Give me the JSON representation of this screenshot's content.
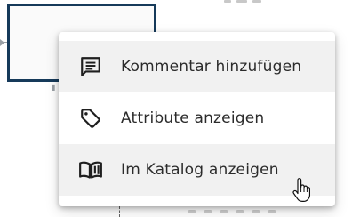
{
  "context_menu": {
    "items": [
      {
        "label": "Kommentar hinzufügen",
        "icon": "comment-icon"
      },
      {
        "label": "Attribute anzeigen",
        "icon": "tag-icon"
      },
      {
        "label": "Im Katalog anzeigen",
        "icon": "open-book-icon"
      }
    ]
  },
  "colors": {
    "node_border": "#163a5a",
    "menu_hover": "#f1f1f1",
    "text": "#2b2b2b",
    "icon": "#1f1f1f"
  }
}
